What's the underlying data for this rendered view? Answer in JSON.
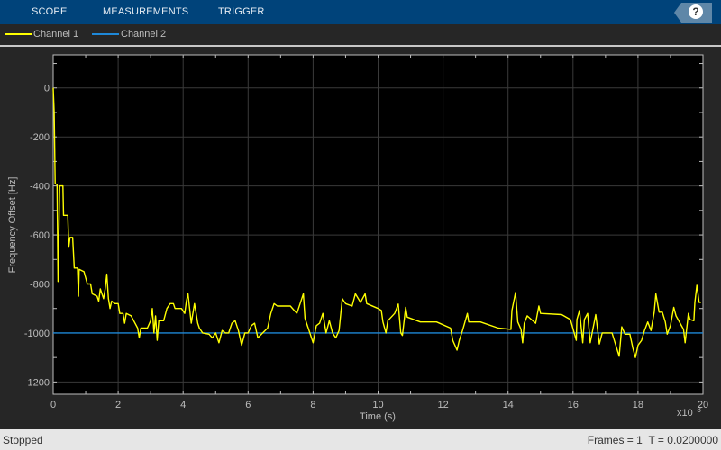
{
  "toolstrip": {
    "tabs": [
      "SCOPE",
      "MEASUREMENTS",
      "TRIGGER"
    ],
    "help_icon": "question-mark-icon",
    "help_label": "?"
  },
  "legend": [
    {
      "label": "Channel 1",
      "color": "#ffff00"
    },
    {
      "label": "Channel 2",
      "color": "#1e88d8"
    }
  ],
  "status": {
    "state": "Stopped",
    "frames": "Frames = 1",
    "time": "T = 0.0200000"
  },
  "chart_data": {
    "type": "line",
    "xlabel": "Time (s)",
    "ylabel": "Frequency Offset [Hz]",
    "x_exponent_label": "x10",
    "x_exponent": "−3",
    "xlim": [
      0,
      20
    ],
    "ylim": [
      -1250,
      135
    ],
    "xticks": [
      0,
      2,
      4,
      6,
      8,
      10,
      12,
      14,
      16,
      18,
      20
    ],
    "yticks": [
      0,
      -200,
      -400,
      -600,
      -800,
      -1000,
      -1200
    ],
    "grid": true,
    "background": "#000000",
    "series": [
      {
        "name": "Channel 1",
        "color": "#ffff00",
        "points": [
          [
            0,
            0
          ],
          [
            0.03,
            -100
          ],
          [
            0.06,
            -390
          ],
          [
            0.12,
            -395
          ],
          [
            0.15,
            -790
          ],
          [
            0.2,
            -400
          ],
          [
            0.3,
            -400
          ],
          [
            0.32,
            -520
          ],
          [
            0.45,
            -520
          ],
          [
            0.48,
            -650
          ],
          [
            0.52,
            -610
          ],
          [
            0.6,
            -610
          ],
          [
            0.65,
            -735
          ],
          [
            0.75,
            -735
          ],
          [
            0.78,
            -850
          ],
          [
            0.8,
            -740
          ],
          [
            0.95,
            -750
          ],
          [
            1.05,
            -800
          ],
          [
            1.15,
            -800
          ],
          [
            1.2,
            -840
          ],
          [
            1.35,
            -850
          ],
          [
            1.4,
            -870
          ],
          [
            1.45,
            -820
          ],
          [
            1.55,
            -860
          ],
          [
            1.6,
            -820
          ],
          [
            1.65,
            -760
          ],
          [
            1.7,
            -860
          ],
          [
            1.75,
            -900
          ],
          [
            1.8,
            -870
          ],
          [
            1.9,
            -880
          ],
          [
            2.0,
            -880
          ],
          [
            2.05,
            -920
          ],
          [
            2.15,
            -920
          ],
          [
            2.2,
            -960
          ],
          [
            2.25,
            -920
          ],
          [
            2.4,
            -930
          ],
          [
            2.6,
            -980
          ],
          [
            2.65,
            -1020
          ],
          [
            2.7,
            -980
          ],
          [
            2.9,
            -980
          ],
          [
            3.0,
            -950
          ],
          [
            3.05,
            -900
          ],
          [
            3.1,
            -1000
          ],
          [
            3.15,
            -930
          ],
          [
            3.2,
            -1030
          ],
          [
            3.25,
            -950
          ],
          [
            3.4,
            -950
          ],
          [
            3.5,
            -900
          ],
          [
            3.6,
            -880
          ],
          [
            3.7,
            -880
          ],
          [
            3.75,
            -900
          ],
          [
            3.95,
            -900
          ],
          [
            4.05,
            -920
          ],
          [
            4.1,
            -870
          ],
          [
            4.15,
            -840
          ],
          [
            4.25,
            -960
          ],
          [
            4.35,
            -880
          ],
          [
            4.45,
            -960
          ],
          [
            4.5,
            -980
          ],
          [
            4.6,
            -1000
          ],
          [
            4.8,
            -1005
          ],
          [
            4.9,
            -1020
          ],
          [
            5.0,
            -1000
          ],
          [
            5.1,
            -1040
          ],
          [
            5.2,
            -990
          ],
          [
            5.3,
            -1000
          ],
          [
            5.4,
            -1000
          ],
          [
            5.5,
            -960
          ],
          [
            5.6,
            -950
          ],
          [
            5.7,
            -990
          ],
          [
            5.8,
            -1050
          ],
          [
            5.9,
            -1000
          ],
          [
            6.0,
            -1000
          ],
          [
            6.1,
            -970
          ],
          [
            6.2,
            -960
          ],
          [
            6.3,
            -1020
          ],
          [
            6.45,
            -1000
          ],
          [
            6.6,
            -980
          ],
          [
            6.7,
            -920
          ],
          [
            6.8,
            -880
          ],
          [
            6.9,
            -890
          ],
          [
            7.3,
            -890
          ],
          [
            7.5,
            -920
          ],
          [
            7.6,
            -880
          ],
          [
            7.7,
            -840
          ],
          [
            7.75,
            -940
          ],
          [
            7.8,
            -960
          ],
          [
            7.9,
            -1000
          ],
          [
            8.0,
            -1040
          ],
          [
            8.1,
            -970
          ],
          [
            8.2,
            -960
          ],
          [
            8.3,
            -920
          ],
          [
            8.4,
            -1000
          ],
          [
            8.5,
            -950
          ],
          [
            8.6,
            -1000
          ],
          [
            8.7,
            -1020
          ],
          [
            8.8,
            -990
          ],
          [
            8.9,
            -860
          ],
          [
            9.0,
            -880
          ],
          [
            9.2,
            -890
          ],
          [
            9.3,
            -840
          ],
          [
            9.46,
            -875
          ],
          [
            9.6,
            -840
          ],
          [
            9.65,
            -880
          ],
          [
            10.0,
            -900
          ],
          [
            10.1,
            -908
          ],
          [
            10.15,
            -955
          ],
          [
            10.24,
            -1000
          ],
          [
            10.3,
            -950
          ],
          [
            10.51,
            -920
          ],
          [
            10.62,
            -882
          ],
          [
            10.7,
            -1000
          ],
          [
            10.75,
            -1010
          ],
          [
            10.85,
            -895
          ],
          [
            10.9,
            -935
          ],
          [
            11.3,
            -955
          ],
          [
            11.8,
            -955
          ],
          [
            12.23,
            -980
          ],
          [
            12.3,
            -1030
          ],
          [
            12.43,
            -1070
          ],
          [
            12.5,
            -1030
          ],
          [
            12.6,
            -990
          ],
          [
            12.75,
            -920
          ],
          [
            12.79,
            -955
          ],
          [
            13.15,
            -955
          ],
          [
            13.7,
            -980
          ],
          [
            14.09,
            -985
          ],
          [
            14.12,
            -908
          ],
          [
            14.23,
            -835
          ],
          [
            14.3,
            -955
          ],
          [
            14.4,
            -985
          ],
          [
            14.45,
            -1040
          ],
          [
            14.5,
            -960
          ],
          [
            14.59,
            -930
          ],
          [
            14.85,
            -960
          ],
          [
            14.95,
            -890
          ],
          [
            15.0,
            -920
          ],
          [
            15.65,
            -925
          ],
          [
            15.92,
            -945
          ],
          [
            16.1,
            -1030
          ],
          [
            16.12,
            -945
          ],
          [
            16.2,
            -908
          ],
          [
            16.3,
            -1040
          ],
          [
            16.35,
            -945
          ],
          [
            16.45,
            -920
          ],
          [
            16.53,
            -1040
          ],
          [
            16.7,
            -925
          ],
          [
            16.81,
            -1045
          ],
          [
            16.9,
            -1000
          ],
          [
            17.2,
            -1000
          ],
          [
            17.42,
            -1095
          ],
          [
            17.5,
            -975
          ],
          [
            17.6,
            -1005
          ],
          [
            17.75,
            -1005
          ],
          [
            17.84,
            -1060
          ],
          [
            17.92,
            -1100
          ],
          [
            18.0,
            -1050
          ],
          [
            18.11,
            -1030
          ],
          [
            18.2,
            -990
          ],
          [
            18.3,
            -955
          ],
          [
            18.4,
            -990
          ],
          [
            18.5,
            -915
          ],
          [
            18.55,
            -840
          ],
          [
            18.65,
            -915
          ],
          [
            18.75,
            -915
          ],
          [
            18.84,
            -955
          ],
          [
            18.9,
            -1005
          ],
          [
            19.0,
            -970
          ],
          [
            19.1,
            -895
          ],
          [
            19.17,
            -930
          ],
          [
            19.4,
            -985
          ],
          [
            19.45,
            -1040
          ],
          [
            19.55,
            -920
          ],
          [
            19.6,
            -945
          ],
          [
            19.72,
            -950
          ],
          [
            19.75,
            -875
          ],
          [
            19.81,
            -805
          ],
          [
            19.88,
            -875
          ],
          [
            19.94,
            -875
          ]
        ]
      },
      {
        "name": "Channel 2",
        "color": "#1e88d8",
        "points": [
          [
            0,
            -1000
          ],
          [
            20,
            -1000
          ]
        ]
      }
    ]
  }
}
